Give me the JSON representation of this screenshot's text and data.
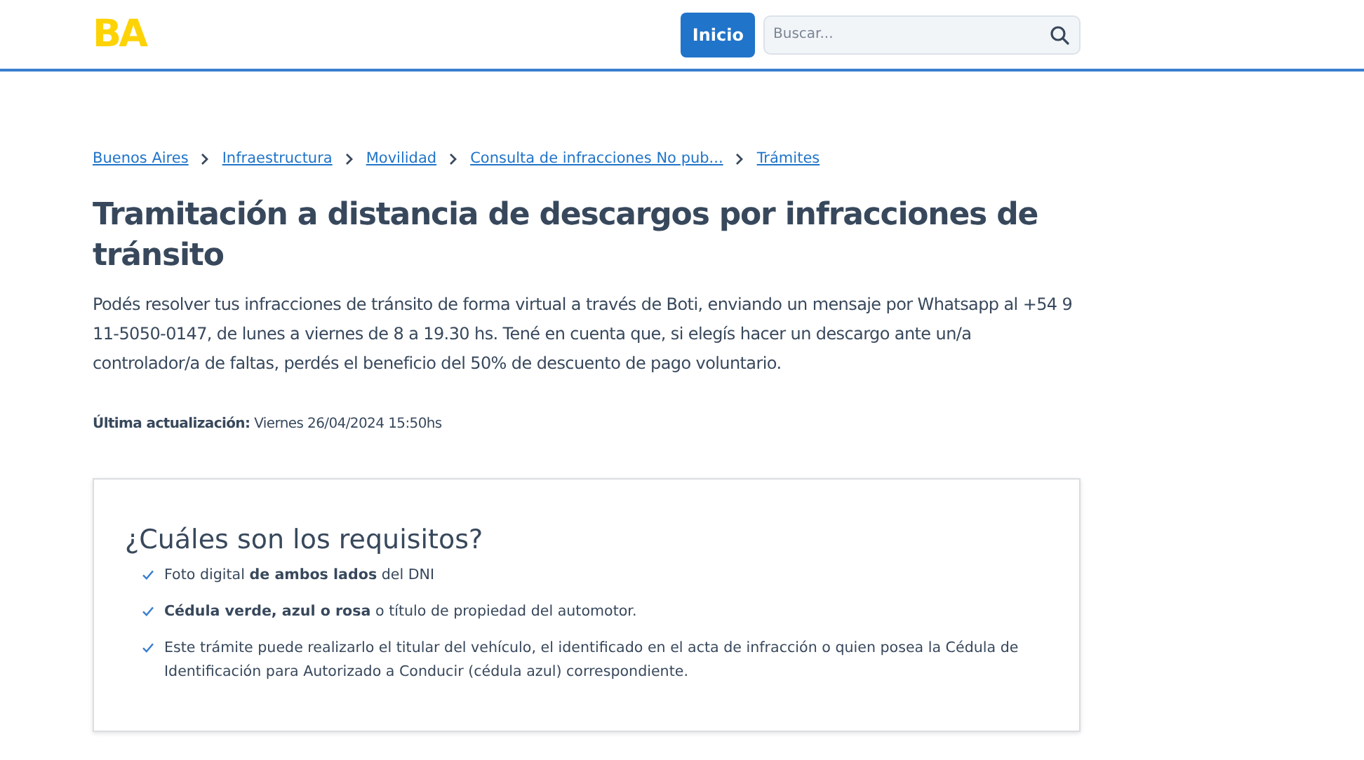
{
  "header": {
    "logo": "BA",
    "home_button": "Inicio",
    "search": {
      "placeholder": "Buscar..."
    }
  },
  "breadcrumb": [
    "Buenos Aires",
    "Infraestructura",
    "Movilidad",
    "Consulta de infracciones No pub...",
    "Trámites"
  ],
  "title": "Tramitación a distancia de descargos por infracciones de tránsito",
  "intro": "Podés resolver tus infracciones de tránsito de forma virtual a través de Boti, enviando un mensaje por Whatsapp al +54 9 11-5050-0147, de lunes a viernes de 8 a 19.30 hs. Tené en cuenta que, si elegís hacer un descargo ante un/a controlador/a de faltas, perdés el beneficio del 50% de descuento de pago voluntario.",
  "last_update": "**Última actualización:** Viernes 26/04/2024 15:50hs",
  "requirements": {
    "title": "¿Cuáles son los requisitos?",
    "items": [
      "Foto digital **de ambos lados** del DNI",
      "**Cédula verde, azul o rosa** o título de propiedad del automotor.",
      "Este trámite puede realizarlo el titular del vehículo, el identificado en el acta de infracción o quien posea la Cédula de Identificación para Autorizado a Conducir (cédula azul) correspondiente."
    ]
  }
}
